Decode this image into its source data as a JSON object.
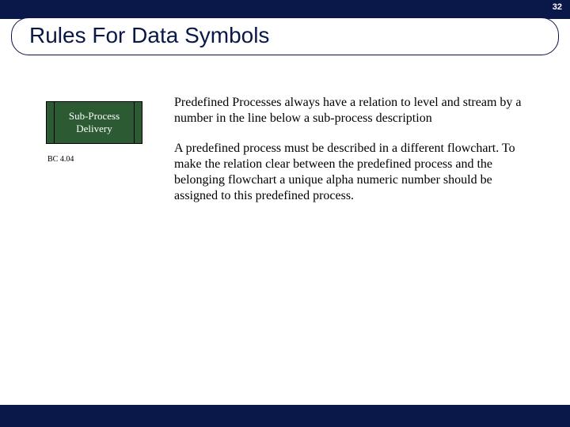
{
  "page_number": "32",
  "title": "Rules For Data Symbols",
  "subprocess": {
    "label_line1": "Sub-Process",
    "label_line2": "Delivery",
    "ref": "BC 4.04"
  },
  "paragraphs": {
    "p1": "Predefined Processes always have a relation to level and stream by a number in the line below a sub-process description",
    "p2": "A predefined process must be described in a different flowchart. To make the relation clear between the predefined process and the belonging flowchart a unique alpha numeric number should be assigned to this predefined process."
  }
}
